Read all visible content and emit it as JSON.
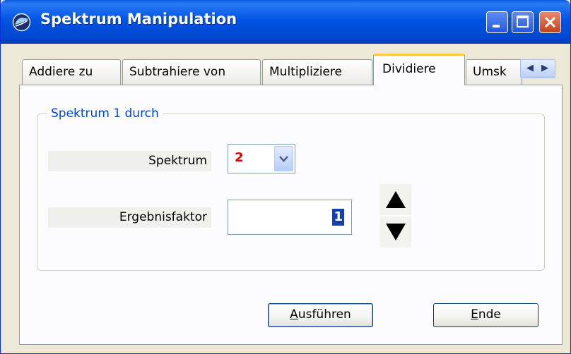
{
  "window": {
    "title": "Spektrum Manipulation"
  },
  "tabs": [
    {
      "label": "Addiere zu",
      "active": false
    },
    {
      "label": "Subtrahiere von",
      "active": false
    },
    {
      "label": "Multipliziere",
      "active": false
    },
    {
      "label": "Dividiere",
      "active": true
    },
    {
      "label": "Umsk",
      "active": false
    }
  ],
  "tab_scroll": {
    "left_glyph": "◀",
    "right_glyph": "▶"
  },
  "group": {
    "legend": "Spektrum 1 durch",
    "spectrum_label": "Spektrum",
    "spectrum_value": "2",
    "factor_label": "Ergebnisfaktor",
    "factor_value": "1"
  },
  "buttons": {
    "execute_first": "A",
    "execute_rest": "usführen",
    "end_first": "E",
    "end_rest": "nde"
  },
  "colors": {
    "titlebar": "#0054e3",
    "legend_text": "#0046d5",
    "spectrum_value": "#e00000",
    "active_tab_accent": "#ffc83c"
  },
  "icons": {
    "app": "spectrum-app-icon",
    "minimize": "minimize-icon",
    "maximize": "maximize-icon",
    "close": "close-icon",
    "dropdown": "chevron-down-icon",
    "spin_up": "triangle-up-icon",
    "spin_down": "triangle-down-icon"
  }
}
